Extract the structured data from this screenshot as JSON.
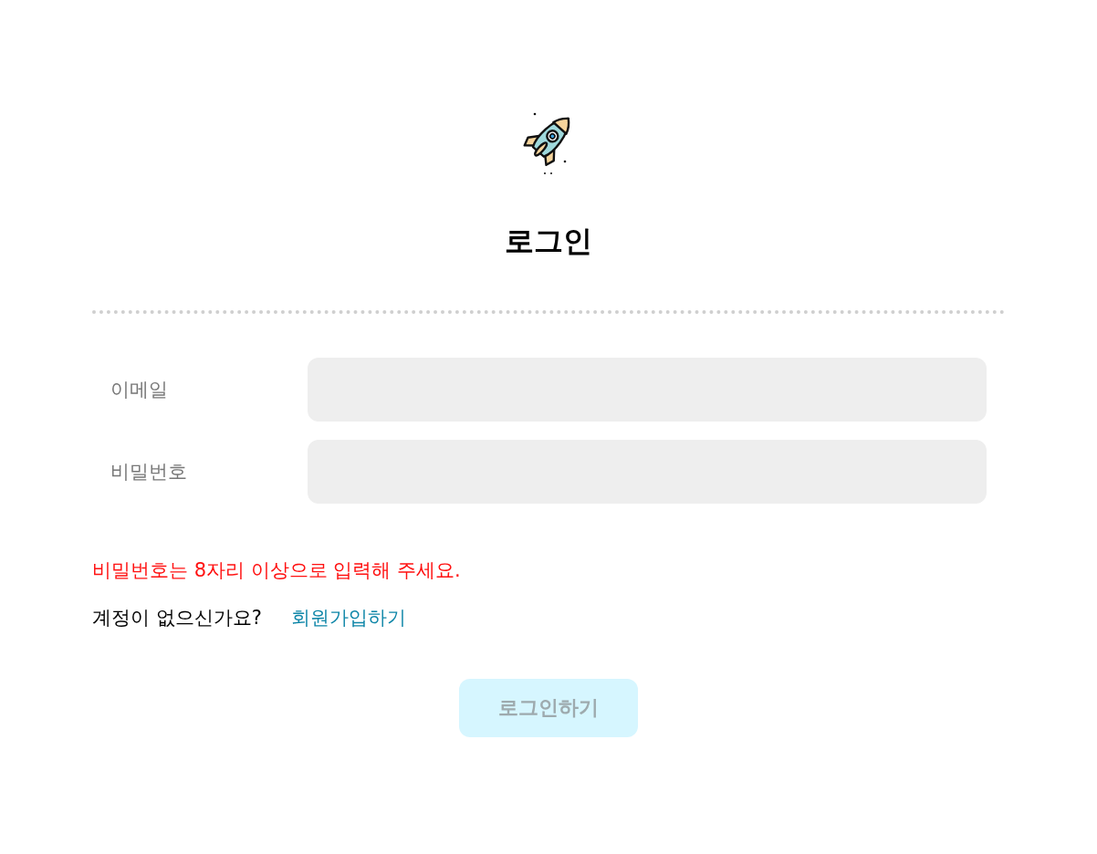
{
  "title": "로그인",
  "fields": [
    {
      "label": "이메일"
    },
    {
      "label": "비밀번호"
    }
  ],
  "error": "비밀번호는 8자리 이상으로 입력해 주세요.",
  "signup": {
    "prompt": "계정이 없으신가요?",
    "link": "회원가입하기"
  },
  "submit": {
    "label": "로그인하기",
    "disabled": true
  }
}
